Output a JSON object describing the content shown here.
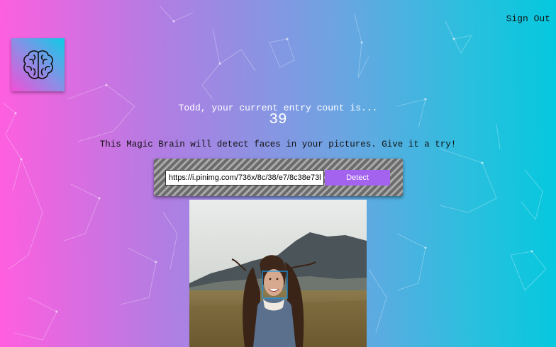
{
  "nav": {
    "sign_out_label": "Sign Out"
  },
  "logo": {
    "icon": "brain-icon"
  },
  "rank": {
    "label": "Todd, your current entry count is...",
    "count": "39"
  },
  "intro": {
    "text": "This Magic Brain will detect faces in your pictures. Give it a try!"
  },
  "form": {
    "url_value": "https://i.pinimg.com/736x/8c/38/e7/8c38e73b",
    "detect_label": "Detect",
    "accent_color": "#a463ef"
  },
  "image": {
    "description_icon": "face-photo"
  },
  "colors": {
    "gradient_left": "#ff5edf",
    "gradient_right": "#04c8de",
    "face_box": "#149df2"
  }
}
